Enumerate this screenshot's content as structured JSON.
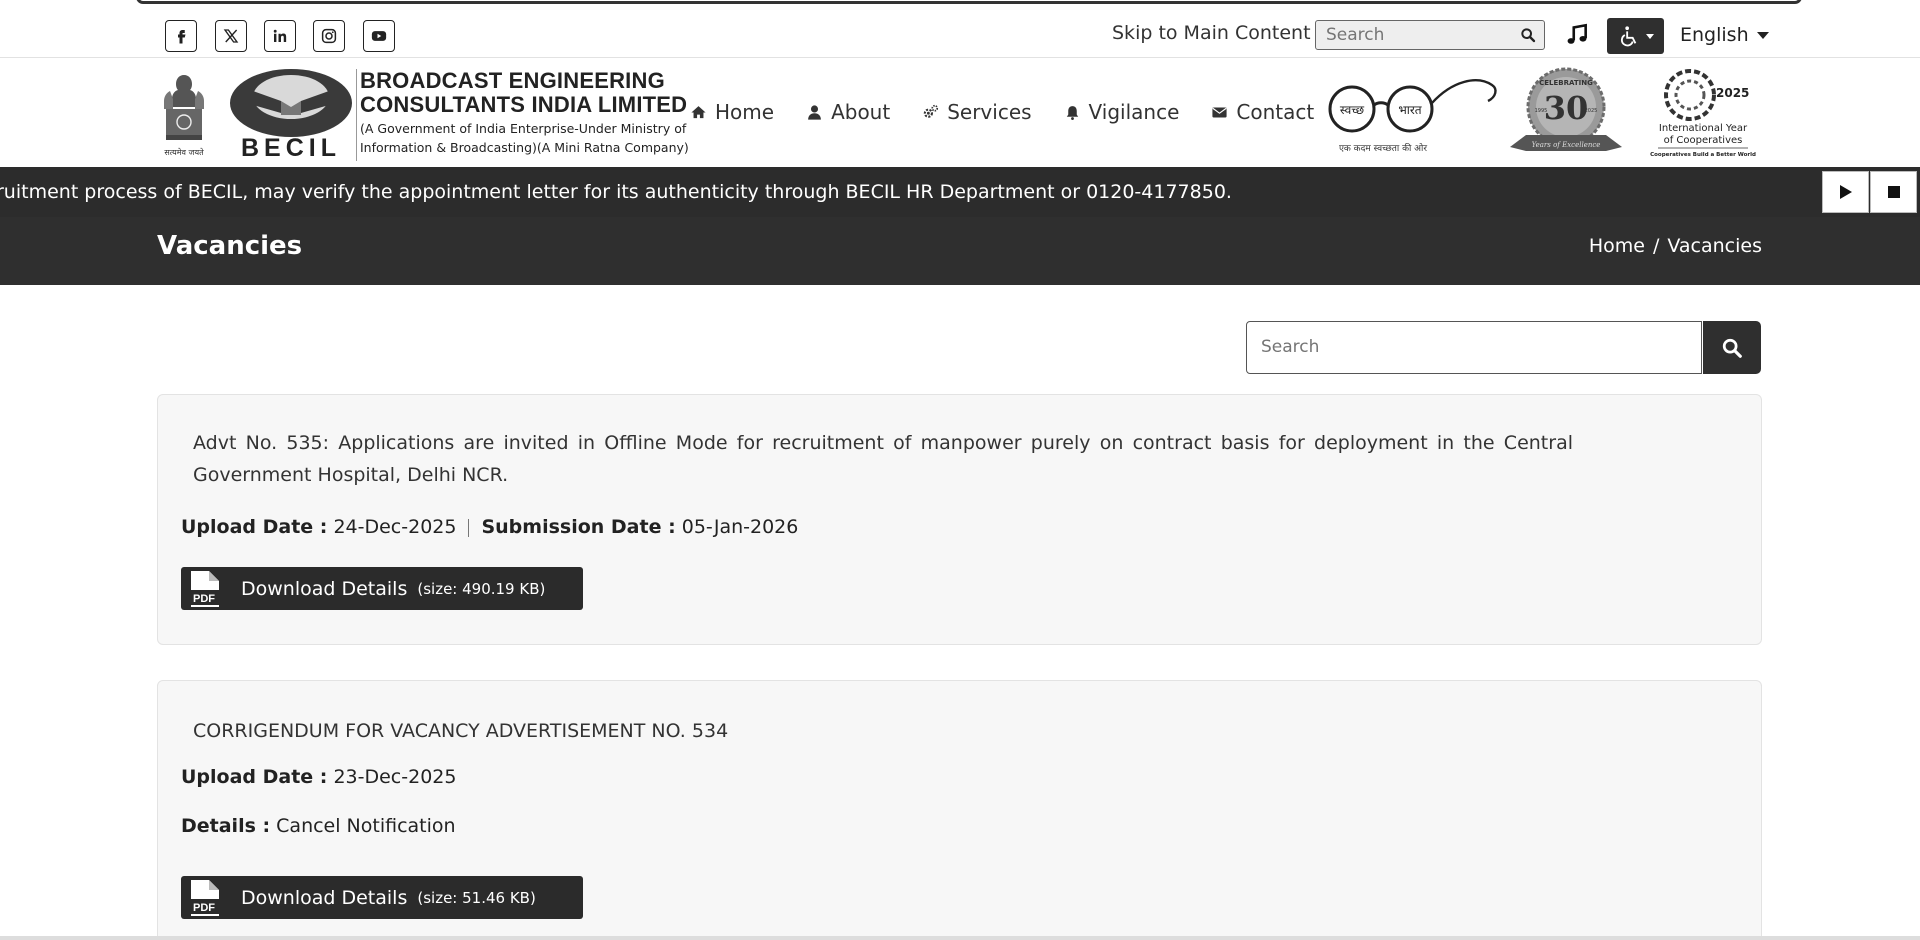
{
  "topbar": {
    "social_icons": [
      "facebook-icon",
      "x-icon",
      "linkedin-icon",
      "instagram-icon",
      "youtube-icon"
    ],
    "skip_link": "Skip to Main Content",
    "search_placeholder": "Search",
    "language": "English"
  },
  "header": {
    "org_line1": "BROADCAST ENGINEERING",
    "org_line2": "CONSULTANTS INDIA LIMITED",
    "org_line3": "(A Government of India Enterprise-Under Ministry of",
    "org_line4": "Information & Broadcasting)(A Mini Ratna Company)",
    "logo_text": "BECIL",
    "emblem_caption": "सत्यमेव जयते",
    "nav": [
      {
        "label": "Home",
        "icon": "home-icon"
      },
      {
        "label": "About",
        "icon": "user-icon"
      },
      {
        "label": "Services",
        "icon": "gears-icon"
      },
      {
        "label": "Vigilance",
        "icon": "bell-icon"
      },
      {
        "label": "Contact",
        "icon": "envelope-icon"
      }
    ],
    "swachh_word1": "स्वच्छ",
    "swachh_word2": "भारत",
    "swachh_caption": "एक कदम स्वच्छता की ओर",
    "celebrating_text": "CELEBRATING",
    "celebrating_number": "30",
    "celebrating_sub": "Years of Excellence",
    "cel_year_left": "1995",
    "cel_year_right": "2025",
    "iyc_year": "2025",
    "iyc_line1": "International Year",
    "iyc_line2": "of Cooperatives",
    "iyc_tagline": "Cooperatives Build a Better World"
  },
  "ticker": {
    "text": "ruitment process of BECIL, may verify the appointment letter for its authenticity through BECIL HR Department or 0120-4177850."
  },
  "page": {
    "title": "Vacancies",
    "breadcrumb_home": "Home",
    "breadcrumb_sep": "/",
    "breadcrumb_current": "Vacancies",
    "search_placeholder": "Search"
  },
  "vacancies": [
    {
      "title": "Advt No. 535: Applications are invited in Offline Mode for recruitment of manpower purely on contract basis for deployment in the Central Government Hospital, Delhi NCR.",
      "upload_label": "Upload Date :",
      "upload_date": "24-Dec-2025",
      "submission_label": "Submission Date :",
      "submission_date": "05-Jan-2026",
      "download_label": "Download Details",
      "size": "(size: 490.19 KB)"
    },
    {
      "title": "CORRIGENDUM FOR VACANCY ADVERTISEMENT NO. 534",
      "upload_label": "Upload Date :",
      "upload_date": "23-Dec-2025",
      "details_label": "Details :",
      "details_value": "Cancel Notification",
      "download_label": "Download Details",
      "size": "(size: 51.46 KB)"
    }
  ],
  "pdf_badge": "PDF"
}
